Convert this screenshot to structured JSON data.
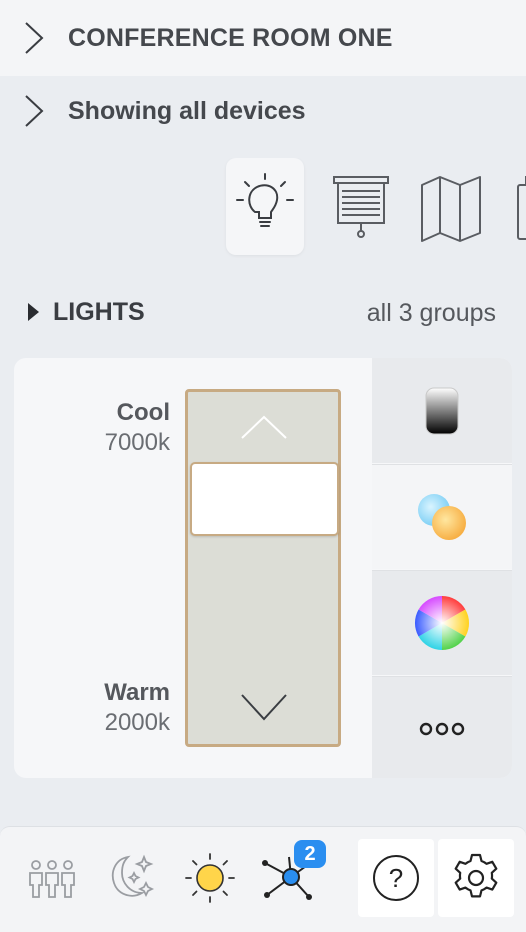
{
  "header": {
    "room_title": "CONFERENCE ROOM ONE",
    "filter_label": "Showing all devices"
  },
  "categories": [
    {
      "icon": "lightbulb-icon",
      "active": true
    },
    {
      "icon": "projector-screen-icon",
      "active": false
    },
    {
      "icon": "map-icon",
      "active": false
    },
    {
      "icon": "device-icon",
      "active": false
    }
  ],
  "section": {
    "title": "LIGHTS",
    "count": "all 3 groups"
  },
  "color_temp": {
    "cool_label": "Cool",
    "cool_value": "7000k",
    "warm_label": "Warm",
    "warm_value": "2000k",
    "level": 0.75
  },
  "modes": [
    {
      "icon": "dimmer-gradient-icon",
      "selected": false
    },
    {
      "icon": "color-temperature-icon",
      "selected": true
    },
    {
      "icon": "color-wheel-icon",
      "selected": false
    },
    {
      "icon": "more-icon",
      "selected": false
    }
  ],
  "bottom_bar": {
    "items": [
      "occupancy-icon",
      "night-scene-icon",
      "daylight-icon",
      "network-icon",
      "help-icon",
      "settings-icon"
    ],
    "network_badge": "2"
  },
  "colors": {
    "accent": "#2a8ef0",
    "slider_border": "#c7aa83",
    "slider_fill": "#dcddd6"
  }
}
